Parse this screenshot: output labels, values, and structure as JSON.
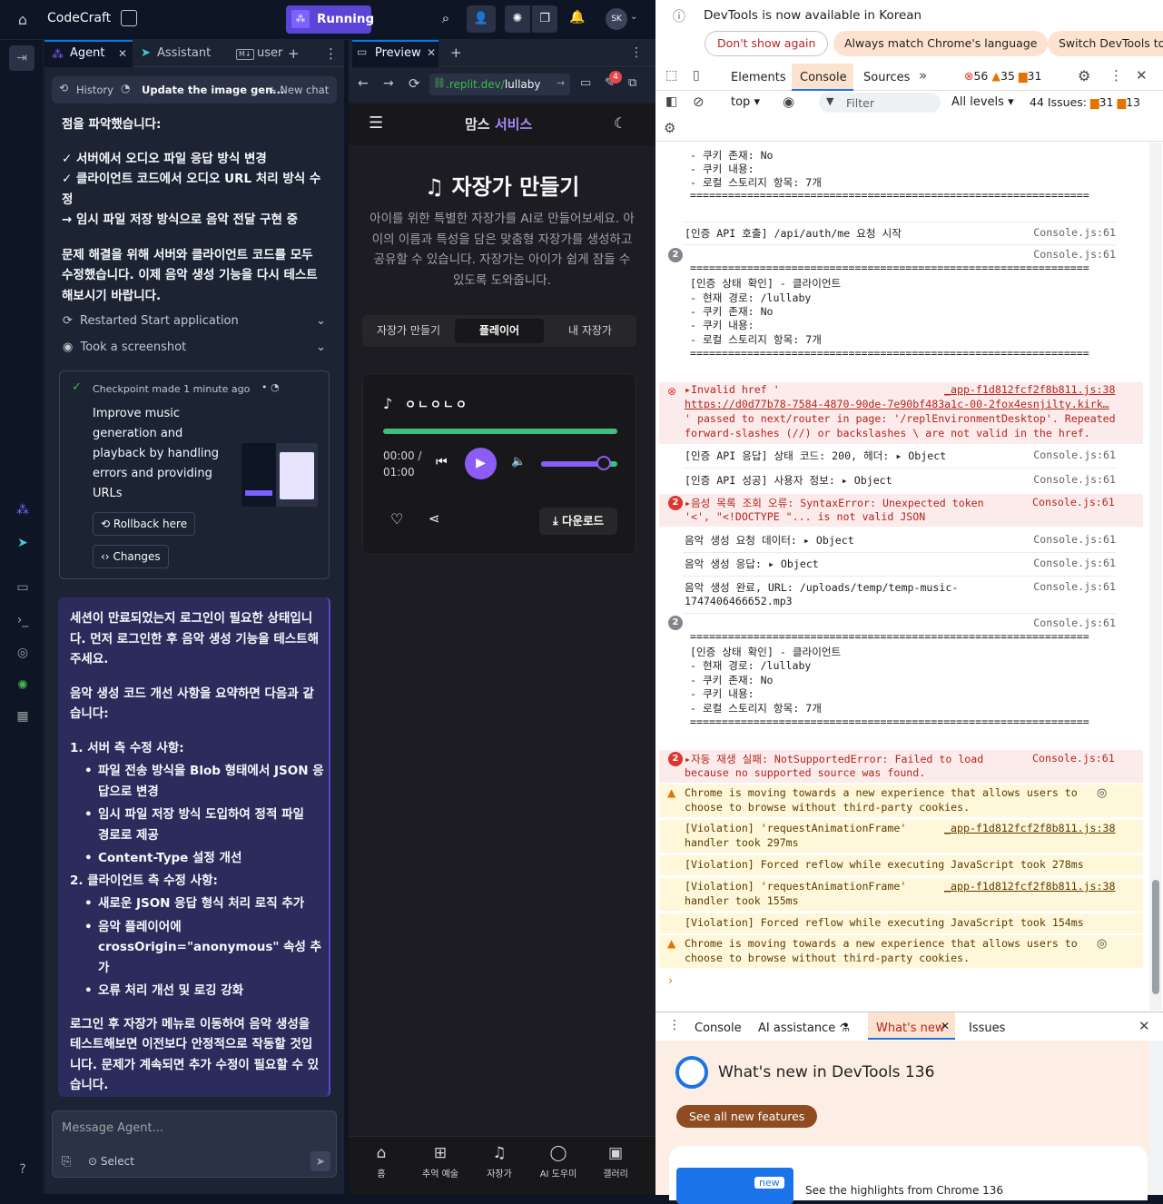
{
  "app": {
    "title": "CodeCraft",
    "run_label": "Running",
    "avatar": "SK"
  },
  "agent": {
    "tabs": [
      {
        "label": "Agent"
      },
      {
        "label": "Assistant"
      },
      {
        "label": "user"
      }
    ],
    "history_label": "History",
    "chat_title": "Update the image gen...",
    "new_chat_label": "New chat",
    "intro_lines": [
      "점을 파악했습니다:",
      "✓ 서버에서 오디오 파일 응답 방식 변경",
      "✓ 클라이언트 코드에서 오디오 URL 처리 방식 수",
      "정",
      "→ 임시 파일 저장 방식으로 음악 전달 구현 중"
    ],
    "para1": [
      "문제 해결을 위해 서버와 클라이언트 코드를 모두",
      "수정했습니다. 이제 음악 생성 기능을 다시 테스트",
      "해보시기 바랍니다."
    ],
    "steps": [
      {
        "label": "Restarted Start application"
      },
      {
        "label": "Took a screenshot"
      }
    ],
    "checkpoint": {
      "meta": "Checkpoint made 1 minute ago",
      "desc_lines": [
        "Improve music",
        "generation and",
        "playback by handling",
        "errors and providing",
        "URLs"
      ],
      "rollback_label": "Rollback here",
      "changes_label": "Changes"
    },
    "message": {
      "p1": [
        "세션이 만료되었는지 로그인이 필요한 상태입니",
        "다. 먼저 로그인한 후 음악 생성 기능을 테스트해",
        "주세요."
      ],
      "p2": [
        "음악 생성 코드 개선 사항을 요약하면 다음과 같",
        "습니다:"
      ],
      "h1": "1. 서버 측 수정 사항:",
      "b1": [
        "파일 전송 방식을 Blob 형태에서 JSON 응",
        "답으로 변경",
        "임시 파일 저장 방식 도입하여 정적 파일",
        "경로로 제공",
        "Content-Type 설정 개선"
      ],
      "h2": "2. 클라이언트 측 수정 사항:",
      "b2": [
        "새로운 JSON 응답 형식 처리 로직 추가",
        "음악 플레이어에",
        "crossOrigin=\"anonymous\" 속성 추가",
        "오류 처리 개선 및 로깅 강화"
      ],
      "p3": [
        "로그인 후 자장가 메뉴로 이동하여 음악 생성을",
        "테스트해보면 이전보다 안정적으로 작동할 것입",
        "니다. 문제가 계속되면 추가 수정이 필요할 수 있",
        "습니다."
      ]
    },
    "input_placeholder": "Message Agent...",
    "select_label": "Select"
  },
  "preview": {
    "tab_label": "Preview",
    "url_prefix": ".replit.dev/",
    "url_path": "lullaby",
    "badge_count": "4",
    "brand1": "맘스",
    "brand2": "서비스",
    "title": "자장가 만들기",
    "desc": [
      "아이를 위한 특별한 자장가를 AI로 만들어보세요. 아",
      "이의 이름과 특성을 담은 맞춤형 자장가를 생성하고",
      "공유할 수 있습니다. 자장가는 아이가 쉽게 잠들 수",
      "있도록 도와줍니다."
    ],
    "segments": [
      "자장가 만들기",
      "플레이어",
      "내 자장가"
    ],
    "player": {
      "title": "ㅇㄴㅇㄴㅇ",
      "time": "00:00 /",
      "duration": "01:00",
      "volume": 0.82,
      "download": "다운로드"
    },
    "nav": [
      "홈",
      "추억 예술",
      "자장가",
      "AI 도우미",
      "갤러리"
    ]
  },
  "devtools": {
    "banner": {
      "text": "DevTools is now available in Korean",
      "btn1": "Don't show again",
      "btn2": "Always match Chrome's language",
      "btn3": "Switch DevTools to"
    },
    "tabs": [
      "Elements",
      "Console",
      "Sources"
    ],
    "errors": "56",
    "warnings": "35",
    "info": "31",
    "context": "top",
    "filter": "Filter",
    "levels": "All levels",
    "issues_label": "44 Issues:",
    "issues_warn": "31",
    "issues_info": "13",
    "src": "Console.js:61",
    "src2": "_app-f1d812fcf2f8b811.js:38",
    "lines": {
      "l0": "- 현재 경로: /lullaby",
      "l1": "- 쿠키 존재: No",
      "l2": "- 쿠키 내용:",
      "l3": "- 로컬 스토리지 항목: 7개",
      "eq": "================================================================",
      "auth_call": "[인증 API 호출] /api/auth/me 요청 시작",
      "auth_state": "[인증 상태 확인] - 클라이언트",
      "invalid1": "▸Invalid href '",
      "invalid2": "https://d0d77b78-7584-4870-90de-7e90bf483a1c-00-2fox4esnjilty.kirk…",
      "invalid3": "' passed to next/router in page: '/replEnvironmentDesktop'. Repeated",
      "invalid4": "forward-slashes (//) or backslashes \\ are not valid in the href.",
      "resp": "[인증 API 응답] 상태 코드: 200, 헤더:",
      "succ": "[인증 API 성공] 사용자 정보:",
      "obj": "▸ Object",
      "musicerr1": "▸음성 목록 조회 오류: SyntaxError: Unexpected token",
      "musicerr2": "'<', \"<!DOCTYPE \"... is not valid JSON",
      "req": "음악 생성 요청 데이터:",
      "gen": "음악 생성 응답:",
      "done1": "음악 생성 완료, URL: /uploads/temp/temp-music-",
      "done2": "1747406466652.mp3",
      "autoplay1": "▸자동 재생 실패: NotSupportedError: Failed to load",
      "autoplay2": "because no supported source was found.",
      "chrome1": "Chrome is moving towards a new experience that allows users to",
      "chrome2": "choose to browse without third-party cookies.",
      "raf1": "[Violation] 'requestAnimationFrame'",
      "raf_a": "handler took 297ms",
      "reflow_a": "[Violation] Forced reflow while executing JavaScript took 278ms",
      "raf_b": "handler took 155ms",
      "reflow_b": "[Violation] Forced reflow while executing JavaScript took 154ms",
      "count2": "2"
    },
    "drawer": {
      "tabs": [
        "Console",
        "AI assistance",
        "What's new",
        "Issues"
      ],
      "heading": "What's new in DevTools 136",
      "btn": "See all new features",
      "card_badge": "new",
      "card_text": "See the highlights from Chrome 136"
    }
  },
  "colors": {
    "accent": "#7b61ff",
    "running": "#5c45d6",
    "console_tab": "#1a73e8"
  }
}
